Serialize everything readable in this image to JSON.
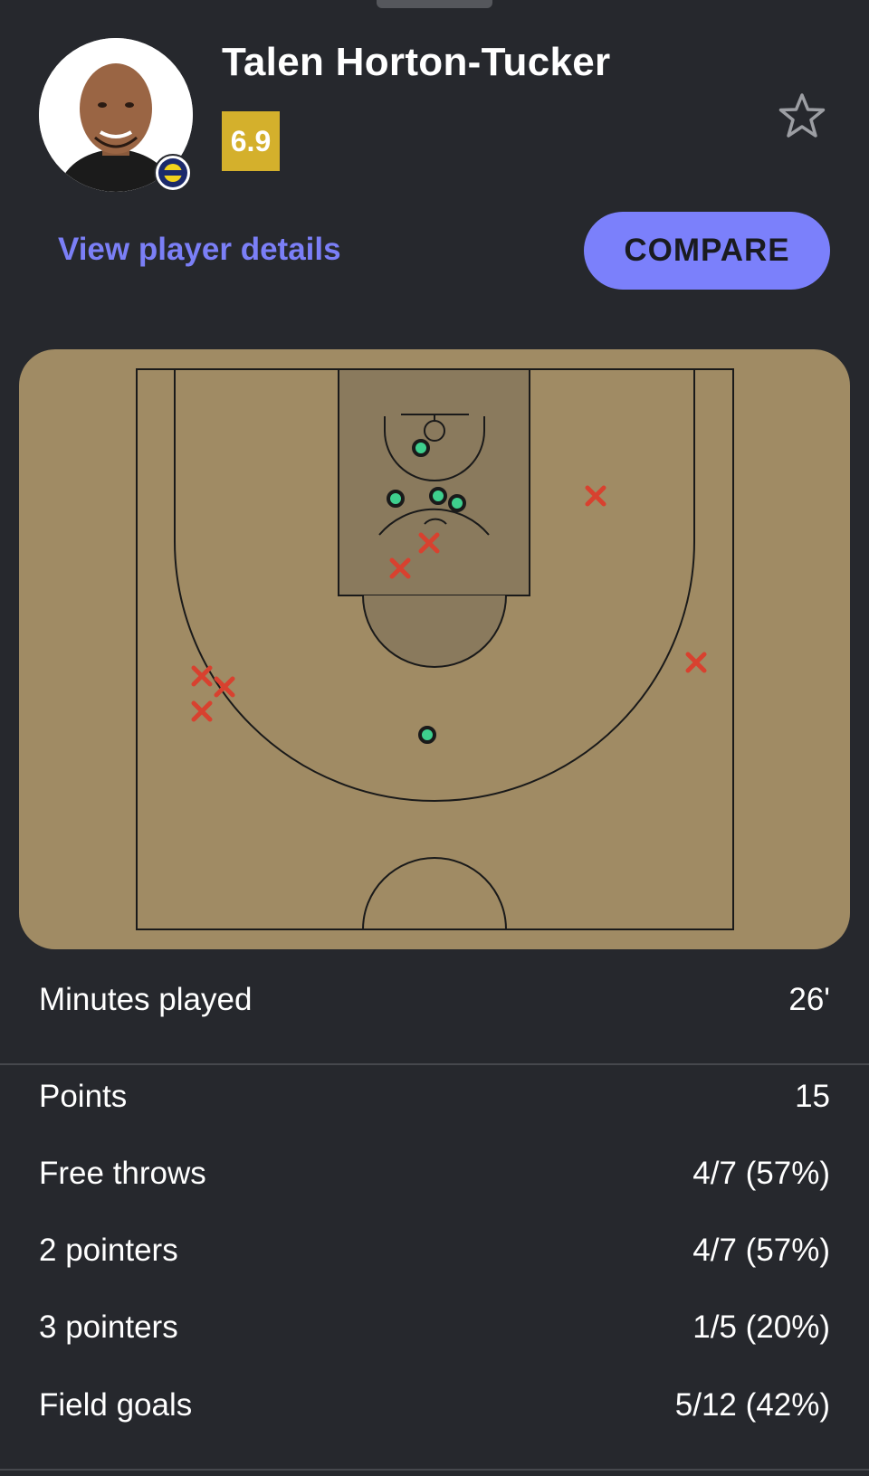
{
  "player": {
    "name": "Talen Horton-Tucker",
    "rating": "6.9"
  },
  "actions": {
    "details_link": "View player details",
    "compare_label": "COMPARE"
  },
  "shot_chart": {
    "made_marker": "circle",
    "missed_marker": "x",
    "made_color": "#3ecf8e",
    "missed_color": "#d8412f",
    "court_color": "#a08b64",
    "made_shots": 5,
    "missed_shots": 7
  },
  "stats": {
    "minutes": {
      "label": "Minutes played",
      "value": "26'"
    },
    "points": {
      "label": "Points",
      "value": "15"
    },
    "free_throws": {
      "label": "Free throws",
      "value": "4/7 (57%)"
    },
    "two_pointers": {
      "label": "2 pointers",
      "value": "4/7 (57%)"
    },
    "three_pointers": {
      "label": "3 pointers",
      "value": "1/5 (20%)"
    },
    "field_goals": {
      "label": "Field goals",
      "value": "5/12 (42%)"
    }
  },
  "icons": {
    "favorite": "star-outline-icon",
    "club": "club-badge-icon"
  }
}
